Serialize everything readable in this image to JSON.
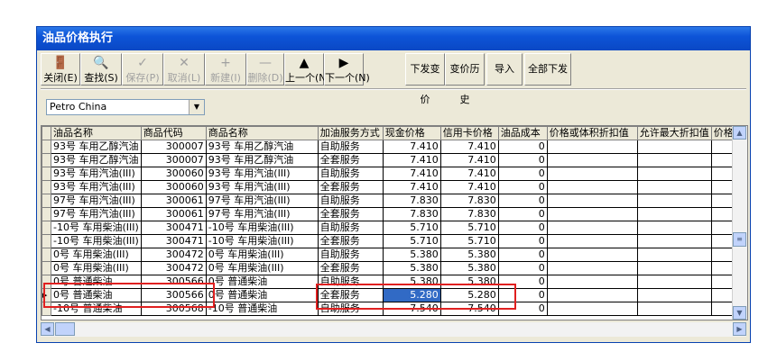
{
  "window": {
    "title": "油品价格执行"
  },
  "toolbar": {
    "close": "关闭(E)",
    "find": "查找(S)",
    "save": "保存(P)",
    "cancel": "取消(L)",
    "new": "新建(I)",
    "delete": "删除(D)",
    "prev": "上一个(N)",
    "next": "下一个(N)",
    "send_price": "下发变价",
    "history": "变价历史",
    "import": "导入",
    "send_all": "全部下发"
  },
  "company_select": {
    "value": "Petro China"
  },
  "grid": {
    "headers": [
      "油品名称",
      "商品代码",
      "商品名称",
      "加油服务方式",
      "现金价格",
      "信用卡价格",
      "油品成本",
      "价格或体积折扣值",
      "允许最大折扣值",
      "价格"
    ],
    "rows": [
      [
        "93号 车用乙醇汽油",
        "300007",
        "93号 车用乙醇汽油",
        "自助服务",
        "7.410",
        "7.410",
        "0"
      ],
      [
        "93号 车用乙醇汽油",
        "300007",
        "93号 车用乙醇汽油",
        "全套服务",
        "7.410",
        "7.410",
        "0"
      ],
      [
        "93号 车用汽油(III)",
        "300060",
        "93号 车用汽油(III)",
        "自助服务",
        "7.410",
        "7.410",
        "0"
      ],
      [
        "93号 车用汽油(III)",
        "300060",
        "93号 车用汽油(III)",
        "全套服务",
        "7.410",
        "7.410",
        "0"
      ],
      [
        "97号 车用汽油(III)",
        "300061",
        "97号 车用汽油(III)",
        "自助服务",
        "7.830",
        "7.830",
        "0"
      ],
      [
        "97号 车用汽油(III)",
        "300061",
        "97号 车用汽油(III)",
        "全套服务",
        "7.830",
        "7.830",
        "0"
      ],
      [
        "-10号 车用柴油(III)",
        "300471",
        "-10号 车用柴油(III)",
        "自助服务",
        "5.710",
        "5.710",
        "0"
      ],
      [
        "-10号 车用柴油(III)",
        "300471",
        "-10号 车用柴油(III)",
        "全套服务",
        "5.710",
        "5.710",
        "0"
      ],
      [
        "0号 车用柴油(III)",
        "300472",
        "0号 车用柴油(III)",
        "自助服务",
        "5.380",
        "5.380",
        "0"
      ],
      [
        "0号 车用柴油(III)",
        "300472",
        "0号 车用柴油(III)",
        "全套服务",
        "5.380",
        "5.380",
        "0"
      ],
      [
        "0号 普通柴油",
        "300566",
        "0号 普通柴油",
        "自助服务",
        "5.380",
        "5.380",
        "0"
      ],
      [
        "0号 普通柴油",
        "300566",
        "0号 普通柴油",
        "全套服务",
        "5.280",
        "5.280",
        "0"
      ],
      [
        "-10号 普通柴油",
        "300568",
        "-10号 普通柴油",
        "自助服务",
        "7.540",
        "7.540",
        "0"
      ]
    ]
  }
}
